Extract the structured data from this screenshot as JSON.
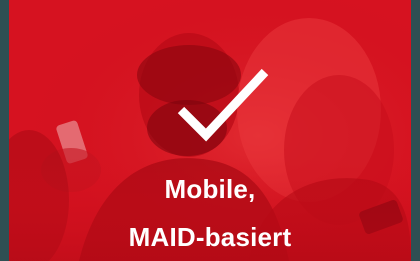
{
  "card": {
    "headline_line1": "Mobile,",
    "headline_line2": "MAID-basiert",
    "icon": "checkmark-icon",
    "accent_color": "#d8101e",
    "background_color": "#2f4f53"
  }
}
